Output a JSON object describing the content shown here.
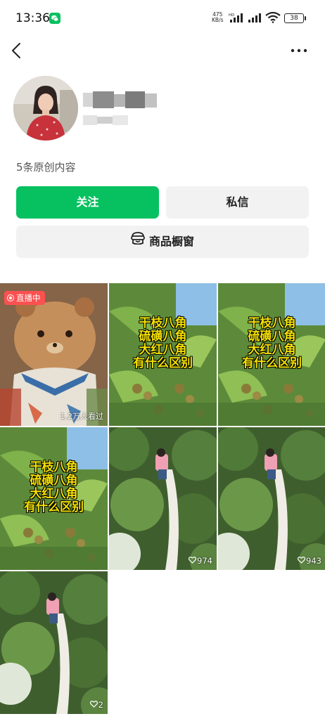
{
  "status_bar": {
    "time": "13:36",
    "net_speed_value": "475",
    "net_speed_unit": "KB/s",
    "hd": "HD",
    "battery": "38"
  },
  "profile": {
    "original_count": "5条原创内容"
  },
  "actions": {
    "follow": "关注",
    "message": "私信",
    "shop": "商品橱窗"
  },
  "grid": {
    "live_badge": "直播中",
    "live_views": "1.2万人看过",
    "caption_lines": [
      "干枝八角",
      "硫磺八角",
      "大红八角",
      "有什么区别"
    ],
    "likes": [
      "974",
      "943",
      "2"
    ]
  },
  "colors": {
    "accent": "#07c160",
    "live": "#fa5151",
    "caption": "#f5e000"
  }
}
